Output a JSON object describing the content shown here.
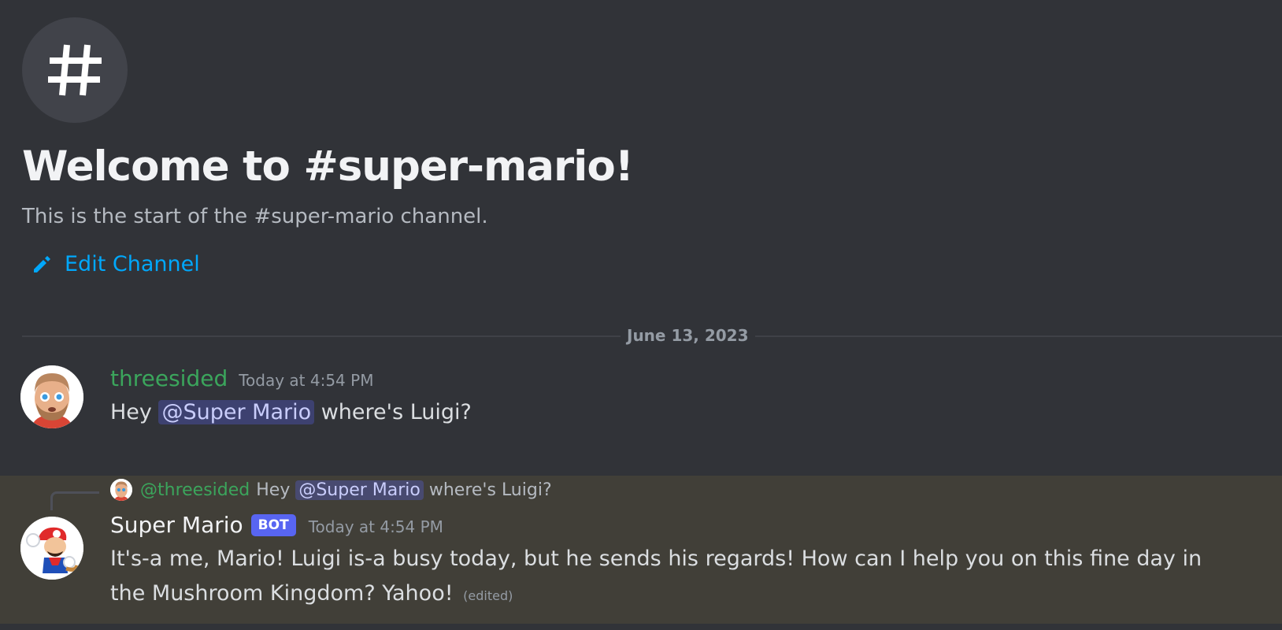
{
  "welcome": {
    "icon": "hash-icon",
    "title": "Welcome to #super-mario!",
    "subtitle": "This is the start of the #super-mario channel.",
    "edit_channel_label": "Edit Channel"
  },
  "date_divider": "June 13, 2023",
  "messages": [
    {
      "username": "threesided",
      "username_color": "#3ba55c",
      "timestamp": "Today at 4:54 PM",
      "avatar": "memoji-avatar",
      "body_prefix": "Hey ",
      "mention": "@Super Mario",
      "body_suffix": " where's Luigi?"
    },
    {
      "reply": {
        "username": "@threesided",
        "text_prefix": "Hey ",
        "mention": "@Super Mario",
        "text_suffix": " where's Luigi?"
      },
      "username": "Super Mario",
      "badge": "BOT",
      "timestamp": "Today at 4:54 PM",
      "avatar": "mario-avatar",
      "body": "It's-a me, Mario! Luigi is-a busy today, but he sends his regards! How can I help you on this fine day in the Mushroom Kingdom? Yahoo!",
      "edited_label": "(edited)"
    }
  ],
  "colors": {
    "background": "#313338",
    "highlighted_message": "#413f38",
    "link": "#00a8fc",
    "bot_badge": "#5865f2"
  }
}
